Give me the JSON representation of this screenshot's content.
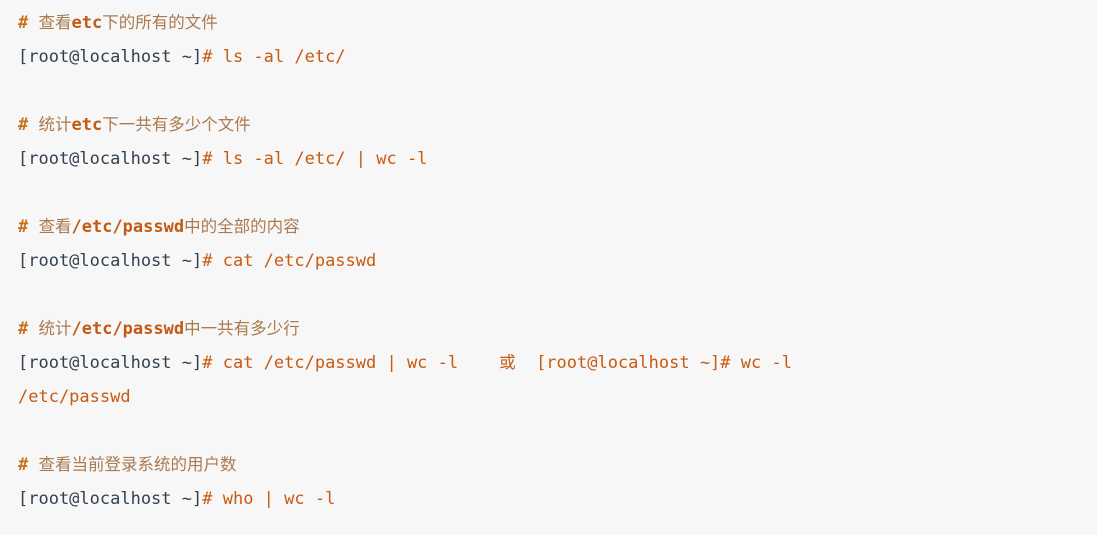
{
  "page": {
    "kind": "code-block",
    "background_color": "#f7f7f7",
    "comment_color": "#ab7a4e",
    "command_color": "#c85a12",
    "prompt_color": "#33414f"
  },
  "lines": [
    {
      "type": "comment",
      "hash": "#",
      "text": "查看etc下的所有的文件",
      "parts": [
        {
          "kind": "cjk",
          "text": "查看"
        },
        {
          "kind": "lit",
          "text": "etc"
        },
        {
          "kind": "cjk",
          "text": "下的所有的文件"
        }
      ]
    },
    {
      "type": "command",
      "prompt": "[root@localhost ~]",
      "hash": "#",
      "command": " ls -al /etc/"
    },
    {
      "type": "blank"
    },
    {
      "type": "comment",
      "hash": "#",
      "text": "统计etc下一共有多少个文件",
      "parts": [
        {
          "kind": "cjk",
          "text": "统计"
        },
        {
          "kind": "lit",
          "text": "etc"
        },
        {
          "kind": "cjk",
          "text": "下一共有多少个文件"
        }
      ]
    },
    {
      "type": "command",
      "prompt": "[root@localhost ~]",
      "hash": "#",
      "command": " ls -al /etc/ | wc -l"
    },
    {
      "type": "blank"
    },
    {
      "type": "comment",
      "hash": "#",
      "text": "查看/etc/passwd中的全部的内容",
      "parts": [
        {
          "kind": "cjk",
          "text": "查看"
        },
        {
          "kind": "lit",
          "text": "/etc/passwd"
        },
        {
          "kind": "cjk",
          "text": "中的全部的内容"
        }
      ]
    },
    {
      "type": "command",
      "prompt": "[root@localhost ~]",
      "hash": "#",
      "command": " cat /etc/passwd"
    },
    {
      "type": "blank"
    },
    {
      "type": "comment",
      "hash": "#",
      "text": "统计/etc/passwd中一共有多少行",
      "parts": [
        {
          "kind": "cjk",
          "text": "统计"
        },
        {
          "kind": "lit",
          "text": "/etc/passwd"
        },
        {
          "kind": "cjk",
          "text": "中一共有多少行"
        }
      ]
    },
    {
      "type": "command-alt",
      "prompt": "[root@localhost ~]",
      "hash": "#",
      "command": " cat /etc/passwd | wc -l",
      "separator": "或",
      "alt_prompt": "[root@localhost ~]#",
      "alt_command": " wc -l"
    },
    {
      "type": "wrap",
      "command": "/etc/passwd"
    },
    {
      "type": "blank"
    },
    {
      "type": "comment",
      "hash": "#",
      "text": "查看当前登录系统的用户数",
      "parts": [
        {
          "kind": "cjk",
          "text": "查看当前登录系统的用户数"
        }
      ]
    },
    {
      "type": "command",
      "prompt": "[root@localhost ~]",
      "hash": "#",
      "command": " who | wc -l"
    }
  ]
}
